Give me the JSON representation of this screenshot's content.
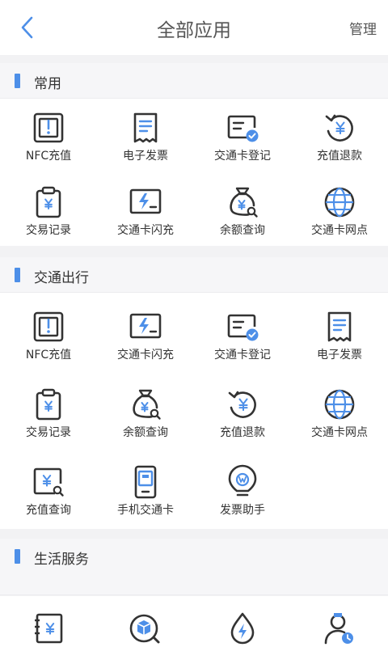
{
  "header": {
    "title": "全部应用",
    "manage_label": "管理"
  },
  "sections": [
    {
      "label": "常用",
      "items": [
        {
          "label": "NFC充值",
          "icon": "nfc-icon"
        },
        {
          "label": "电子发票",
          "icon": "receipt-icon"
        },
        {
          "label": "交通卡登记",
          "icon": "card-check-icon"
        },
        {
          "label": "充值退款",
          "icon": "refund-icon"
        },
        {
          "label": "交易记录",
          "icon": "clipboard-yen-icon"
        },
        {
          "label": "交通卡闪充",
          "icon": "flash-card-icon"
        },
        {
          "label": "余额查询",
          "icon": "money-bag-search-icon"
        },
        {
          "label": "交通卡网点",
          "icon": "globe-icon"
        }
      ]
    },
    {
      "label": "交通出行",
      "items": [
        {
          "label": "NFC充值",
          "icon": "nfc-icon"
        },
        {
          "label": "交通卡闪充",
          "icon": "flash-card-icon"
        },
        {
          "label": "交通卡登记",
          "icon": "card-check-icon"
        },
        {
          "label": "电子发票",
          "icon": "receipt-icon"
        },
        {
          "label": "交易记录",
          "icon": "clipboard-yen-icon"
        },
        {
          "label": "余额查询",
          "icon": "money-bag-search-icon"
        },
        {
          "label": "充值退款",
          "icon": "refund-icon"
        },
        {
          "label": "交通卡网点",
          "icon": "globe-icon"
        },
        {
          "label": "充值查询",
          "icon": "yen-search-icon"
        },
        {
          "label": "手机交通卡",
          "icon": "phone-card-icon"
        },
        {
          "label": "发票助手",
          "icon": "bulb-w-icon"
        }
      ]
    },
    {
      "label": "生活服务",
      "items": [
        {
          "label": "",
          "icon": "notebook-yen-icon"
        },
        {
          "label": "",
          "icon": "package-search-icon"
        },
        {
          "label": "",
          "icon": "water-drop-icon"
        },
        {
          "label": "",
          "icon": "doctor-icon"
        }
      ]
    }
  ],
  "colors": {
    "accent": "#4d8fe8",
    "icon_stroke": "#333333",
    "icon_accent": "#4d8fe8"
  }
}
